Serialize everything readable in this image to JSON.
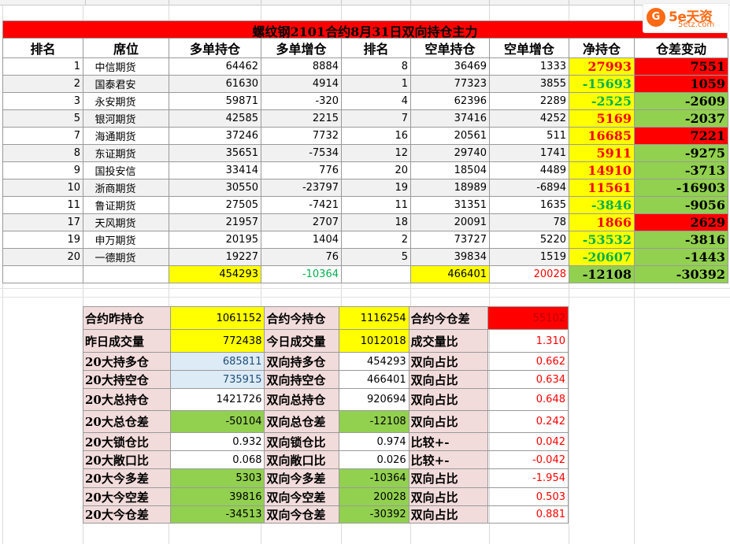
{
  "title": "螺纹钢2101合约8月31日双向持仓主力",
  "logo": {
    "brand": "5e天资",
    "site": "5etz.com",
    "mark": "G"
  },
  "headers": [
    "排名",
    "席位",
    "多单持仓",
    "多单增仓",
    "排名",
    "空单持仓",
    "空单增仓",
    "净持仓",
    "仓差变动"
  ],
  "rows": [
    {
      "rank": "1",
      "seat": "中信期货",
      "long": "64462",
      "long_chg": "8884",
      "s_rank": "8",
      "short": "36469",
      "short_chg": "1333",
      "net": "27993",
      "net_sign": "pos",
      "diff": "7551",
      "diff_sign": "pos"
    },
    {
      "rank": "2",
      "seat": "国泰君安",
      "long": "61630",
      "long_chg": "4914",
      "s_rank": "1",
      "short": "77323",
      "short_chg": "3855",
      "net": "-15693",
      "net_sign": "neg",
      "diff": "1059",
      "diff_sign": "pos"
    },
    {
      "rank": "3",
      "seat": "永安期货",
      "long": "59871",
      "long_chg": "-320",
      "s_rank": "4",
      "short": "62396",
      "short_chg": "2289",
      "net": "-2525",
      "net_sign": "neg",
      "diff": "-2609",
      "diff_sign": "neg"
    },
    {
      "rank": "5",
      "seat": "银河期货",
      "long": "42585",
      "long_chg": "2215",
      "s_rank": "7",
      "short": "37416",
      "short_chg": "4252",
      "net": "5169",
      "net_sign": "pos",
      "diff": "-2037",
      "diff_sign": "neg"
    },
    {
      "rank": "7",
      "seat": "海通期货",
      "long": "37246",
      "long_chg": "7732",
      "s_rank": "16",
      "short": "20561",
      "short_chg": "511",
      "net": "16685",
      "net_sign": "pos",
      "diff": "7221",
      "diff_sign": "pos"
    },
    {
      "rank": "8",
      "seat": "东证期货",
      "long": "35651",
      "long_chg": "-7534",
      "s_rank": "12",
      "short": "29740",
      "short_chg": "1741",
      "net": "5911",
      "net_sign": "pos",
      "diff": "-9275",
      "diff_sign": "neg"
    },
    {
      "rank": "9",
      "seat": "国投安信",
      "long": "33414",
      "long_chg": "776",
      "s_rank": "20",
      "short": "18504",
      "short_chg": "4489",
      "net": "14910",
      "net_sign": "pos",
      "diff": "-3713",
      "diff_sign": "neg"
    },
    {
      "rank": "10",
      "seat": "浙商期货",
      "long": "30550",
      "long_chg": "-23797",
      "s_rank": "19",
      "short": "18989",
      "short_chg": "-6894",
      "net": "11561",
      "net_sign": "pos",
      "diff": "-16903",
      "diff_sign": "neg"
    },
    {
      "rank": "11",
      "seat": "鲁证期货",
      "long": "27505",
      "long_chg": "-7421",
      "s_rank": "11",
      "short": "31351",
      "short_chg": "1635",
      "net": "-3846",
      "net_sign": "neg",
      "diff": "-9056",
      "diff_sign": "neg"
    },
    {
      "rank": "17",
      "seat": "天风期货",
      "long": "21957",
      "long_chg": "2707",
      "s_rank": "18",
      "short": "20091",
      "short_chg": "78",
      "net": "1866",
      "net_sign": "pos",
      "diff": "2629",
      "diff_sign": "pos"
    },
    {
      "rank": "19",
      "seat": "申万期货",
      "long": "20195",
      "long_chg": "1404",
      "s_rank": "2",
      "short": "73727",
      "short_chg": "5220",
      "net": "-53532",
      "net_sign": "neg",
      "diff": "-3816",
      "diff_sign": "neg"
    },
    {
      "rank": "20",
      "seat": "一德期货",
      "long": "19227",
      "long_chg": "76",
      "s_rank": "5",
      "short": "39834",
      "short_chg": "1519",
      "net": "-20607",
      "net_sign": "neg",
      "diff": "-1443",
      "diff_sign": "neg"
    }
  ],
  "totals": {
    "long": "454293",
    "long_chg": "-10364",
    "short": "466401",
    "short_chg": "20028",
    "net": "-12108",
    "diff": "-30392"
  },
  "summary": [
    {
      "l1": "合约昨持仓",
      "v1": "1061152",
      "c1": "yel",
      "l2": "合约今持仓",
      "v2": "1116254",
      "c2": "yel",
      "l3": "合约今仓差",
      "v3": "55102",
      "c3": "red"
    },
    {
      "l1": "昨日成交量",
      "v1": "772438",
      "c1": "yel",
      "l2": "今日成交量",
      "v2": "1012018",
      "c2": "yel",
      "l3": "成交量比",
      "v3": "1.310",
      "c3": "rt"
    },
    {
      "l1": "20大持多仓",
      "v1": "685811",
      "c1": "blu",
      "l2": "双向持多仓",
      "v2": "454293",
      "c2": "wh",
      "l3": "双向占比",
      "v3": "0.662",
      "c3": "rt"
    },
    {
      "l1": "20大持空仓",
      "v1": "735915",
      "c1": "blu",
      "l2": "双向持空仓",
      "v2": "466401",
      "c2": "wh",
      "l3": "双向占比",
      "v3": "0.634",
      "c3": "rt"
    },
    {
      "l1": "20大总持仓",
      "v1": "1421726",
      "c1": "wh",
      "l2": "双向总持仓",
      "v2": "920694",
      "c2": "wh",
      "l3": "双向占比",
      "v3": "0.648",
      "c3": "rt"
    },
    {
      "l1": "20大总仓差",
      "v1": "-50104",
      "c1": "grn",
      "l2": "双向总仓差",
      "v2": "-12108",
      "c2": "grn",
      "l3": "双向占比",
      "v3": "0.242",
      "c3": "rt"
    },
    {
      "l1": "20大锁仓比",
      "v1": "0.932",
      "c1": "wh",
      "l2": "双向锁仓比",
      "v2": "0.974",
      "c2": "wh",
      "l3": "比较+-",
      "v3": "0.042",
      "c3": "rt"
    },
    {
      "l1": "20大敞口比",
      "v1": "0.068",
      "c1": "wh",
      "l2": "双向敞口比",
      "v2": "0.026",
      "c2": "wh",
      "l3": "比较+-",
      "v3": "-0.042",
      "c3": "rt"
    },
    {
      "l1": "20大今多差",
      "v1": "5303",
      "c1": "grn",
      "l2": "双向今多差",
      "v2": "-10364",
      "c2": "grn",
      "l3": "双向占比",
      "v3": "-1.954",
      "c3": "rt"
    },
    {
      "l1": "20大今空差",
      "v1": "39816",
      "c1": "grn",
      "l2": "双向今空差",
      "v2": "20028",
      "c2": "grn",
      "l3": "双向占比",
      "v3": "0.503",
      "c3": "rt"
    },
    {
      "l1": "20大今仓差",
      "v1": "-34513",
      "c1": "grn",
      "l2": "双向今仓差",
      "v2": "-30392",
      "c2": "grn",
      "l3": "双向占比",
      "v3": "0.881",
      "c3": "rt"
    }
  ],
  "colors": {
    "red": "#ff0000",
    "yellow": "#ffff00",
    "green": "#92d050",
    "light_blue": "#ddebf7",
    "pink": "#f2dcdb",
    "green_text": "#00b050"
  }
}
